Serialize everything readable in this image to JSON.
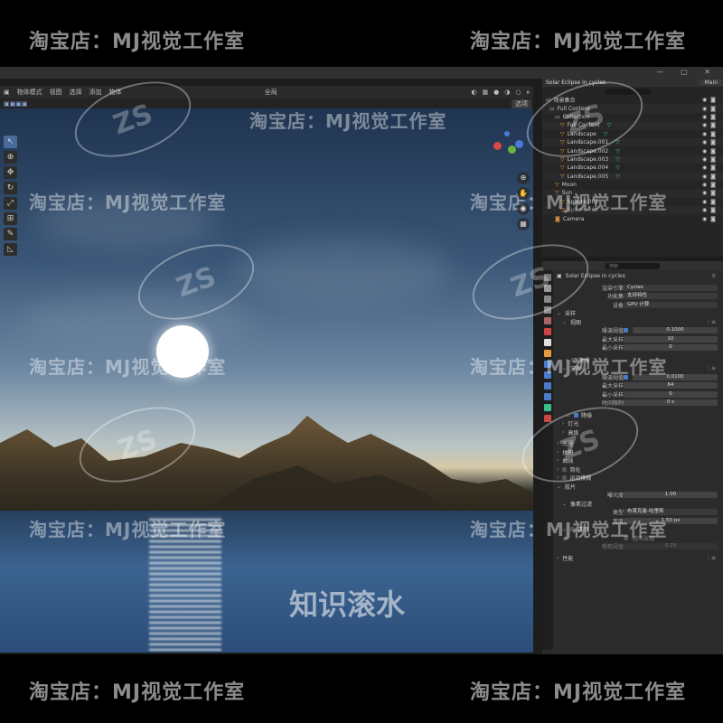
{
  "watermarks": {
    "shop": "淘宝店：MJ视觉工作室",
    "logo": "ZS",
    "bottom_center": "知识滚水"
  },
  "viewport": {
    "mode": "物体模式",
    "menus": [
      "视图",
      "选择",
      "添加",
      "物体"
    ],
    "transform": "全局",
    "options": "选项"
  },
  "outliner": {
    "title": "Solar Eclipse in cycles",
    "scene": "Main",
    "search_placeholder": "",
    "items": [
      {
        "label": "场景集合",
        "icon": "collection-icon"
      },
      {
        "label": "Full Content",
        "icon": "collection-icon"
      },
      {
        "label": "Collection",
        "icon": "collection-icon"
      },
      {
        "label": "Full Content",
        "icon": "mesh-icon"
      },
      {
        "label": "Landscape",
        "icon": "mesh-icon"
      },
      {
        "label": "Landscape.001",
        "icon": "mesh-icon"
      },
      {
        "label": "Landscape.002",
        "icon": "mesh-icon"
      },
      {
        "label": "Landscape.003",
        "icon": "mesh-icon"
      },
      {
        "label": "Landscape.004",
        "icon": "mesh-icon"
      },
      {
        "label": "Landscape.005",
        "icon": "mesh-icon"
      },
      {
        "label": "Moon",
        "icon": "mesh-icon"
      },
      {
        "label": "Sun",
        "icon": "light-icon"
      },
      {
        "label": "Sphere.001",
        "icon": "mesh-icon"
      },
      {
        "label": "Sphere.002",
        "icon": "mesh-icon"
      },
      {
        "label": "Camera",
        "icon": "camera-icon"
      }
    ]
  },
  "properties": {
    "search_placeholder": "搜索",
    "scene_name": "Solar Eclipse in cycles",
    "render_engine_label": "渲染引擎",
    "render_engine": "Cycles",
    "feature_set_label": "功能集",
    "feature_set": "支持特性",
    "device_label": "设备",
    "device": "GPU 计算",
    "sampling": "采样",
    "viewport_sec": "视图",
    "noise_threshold_label": "噪波阈值",
    "vp_noise_threshold": "0.1000",
    "max_samples_label": "最大采样",
    "vp_max_samples": "10",
    "min_samples_label": "最小采样",
    "vp_min_samples": "0",
    "denoise": "降噪",
    "render_sec": "渲染",
    "r_noise_threshold": "0.0100",
    "r_max_samples": "64",
    "r_min_samples": "0",
    "time_limit_label": "时间限制",
    "r_time_limit": "0 s",
    "lights": "灯光",
    "advanced": "高级",
    "light_paths": "光程",
    "volumes": "体积",
    "curves": "曲线",
    "simplify": "简化",
    "motion_blur": "运动模糊",
    "film": "胶片",
    "exposure_label": "曝光度",
    "exposure": "1.00",
    "pixel_filter": "像素过滤",
    "type_label": "类型",
    "filter_type": "布莱克曼-哈里斯",
    "width_label": "宽度",
    "filter_width": "1.50 px",
    "transparent": "透明",
    "transparent_glass": "透明玻璃",
    "roughness_threshold_label": "粗糙阈值",
    "roughness_threshold": "0.10",
    "performance": "性能"
  }
}
